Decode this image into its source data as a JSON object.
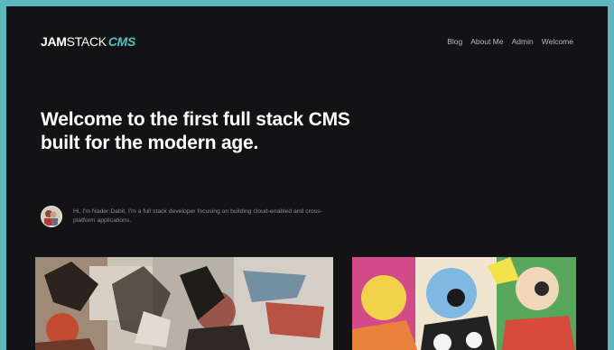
{
  "brand": {
    "part1": "JAM",
    "part2": "STACK",
    "part3": "CMS"
  },
  "nav": {
    "items": [
      "Blog",
      "About Me",
      "Admin",
      "Welcome"
    ]
  },
  "hero": {
    "title": "Welcome to the first full stack CMS built for the modern age."
  },
  "author": {
    "bio": "Hi, I'm Nader Dabit. I'm a full stack developer focusing on building cloud-enabled and cross-platform applications."
  },
  "colors": {
    "frame": "#5db8bd",
    "background": "#131315",
    "accent": "#4fc1c6",
    "nav_text": "#b9b9bd",
    "bio_text": "#8d8d93"
  }
}
